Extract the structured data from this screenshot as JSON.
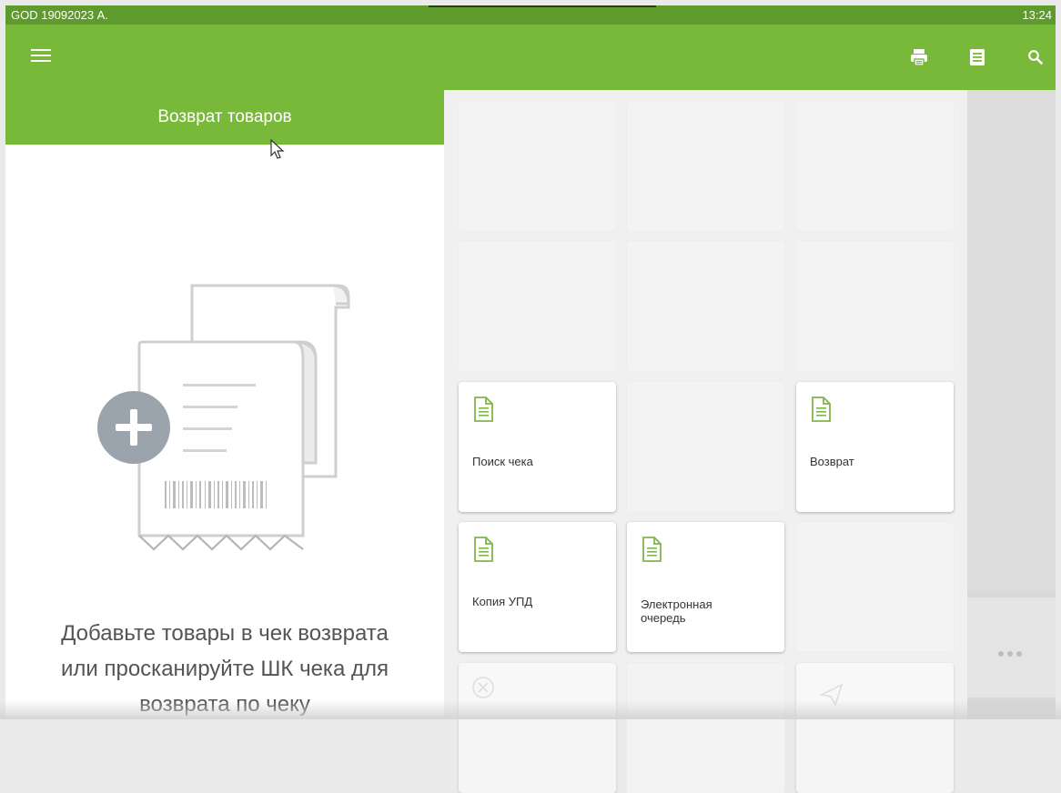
{
  "status_bar": {
    "user": "GOD 19092023 А.",
    "time": "13:24"
  },
  "app_bar": {
    "icons": [
      "menu-icon",
      "printer-icon",
      "receipt-list-icon",
      "search-icon"
    ]
  },
  "left_panel": {
    "header": "Возврат товаров",
    "empty_message": [
      "Добавьте товары в чек возврата",
      "или просканируйте ШК чека для",
      "возврата по чеку"
    ]
  },
  "tiles": {
    "receipt_search": "Поиск чека",
    "return": "Возврат",
    "upd_copy": "Копия УПД",
    "electronic_queue": [
      "Электронная",
      "очередь"
    ]
  },
  "colors": {
    "accent": "#78b93a",
    "status_bar": "#5f9a2c",
    "text_muted": "#545454",
    "icon_green": "#7fb54a"
  }
}
